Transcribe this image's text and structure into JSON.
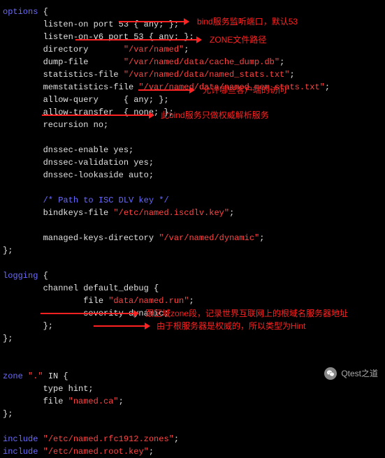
{
  "code": {
    "options_kw": "options",
    "listen_on": "        listen-on port 53 { any; };",
    "listen_on_v6": "        listen-on-v6 port 53 { any; };",
    "directory_lbl": "        directory       ",
    "directory_val": "\"/var/named\"",
    "dump_file_lbl": "        dump-file       ",
    "dump_file_val": "\"/var/named/data/cache_dump.db\"",
    "stats_lbl": "        statistics-file ",
    "stats_val": "\"/var/named/data/named_stats.txt\"",
    "memstats_lbl": "        memstatistics-file ",
    "memstats_val": "\"/var/named/data/named_mem_stats.txt\"",
    "allow_query": "        allow-query     { any; };",
    "allow_transfer": "        allow-transfer  { none; };",
    "recursion": "        recursion no;",
    "dnssec_enable": "        dnssec-enable yes;",
    "dnssec_validation": "        dnssec-validation yes;",
    "dnssec_lookaside": "        dnssec-lookaside auto;",
    "path_comment": "        /* Path to ISC DLV key */",
    "bindkeys_lbl": "        bindkeys-file ",
    "bindkeys_val": "\"/etc/named.iscdlv.key\"",
    "managed_lbl": "        managed-keys-directory ",
    "managed_val": "\"/var/named/dynamic\"",
    "close1": "};",
    "logging_kw": "logging",
    "channel": "        channel default_debug {",
    "file_lbl": "                file ",
    "file_val": "\"data/named.run\"",
    "severity": "                severity dynamic;",
    "close_inner": "        };",
    "close2": "};",
    "zone_kw": "zone",
    "zone_name": " \".\" ",
    "zone_in": "IN {",
    "type_hint": "        type hint;",
    "zfile_lbl": "        file ",
    "zfile_val": "\"named.ca\"",
    "close3": "};",
    "include1_kw": "include",
    "include1_val": " \"/etc/named.rfc1912.zones\"",
    "include2_kw": "include",
    "include2_val": " \"/etc/named.root.key\""
  },
  "annotations": {
    "a1": "bind服务监听端口，默认53",
    "a2": "ZONE文件路径",
    "a3": "允许哪些客户端的访问",
    "a4": "此bind服务只做权威解析服务",
    "a5": "跟区域zone段，记录世界互联网上的根域名服务器地址",
    "a6": "由于根服务器是权威的，所以类型为Hint"
  },
  "watermark": "Qtest之道"
}
